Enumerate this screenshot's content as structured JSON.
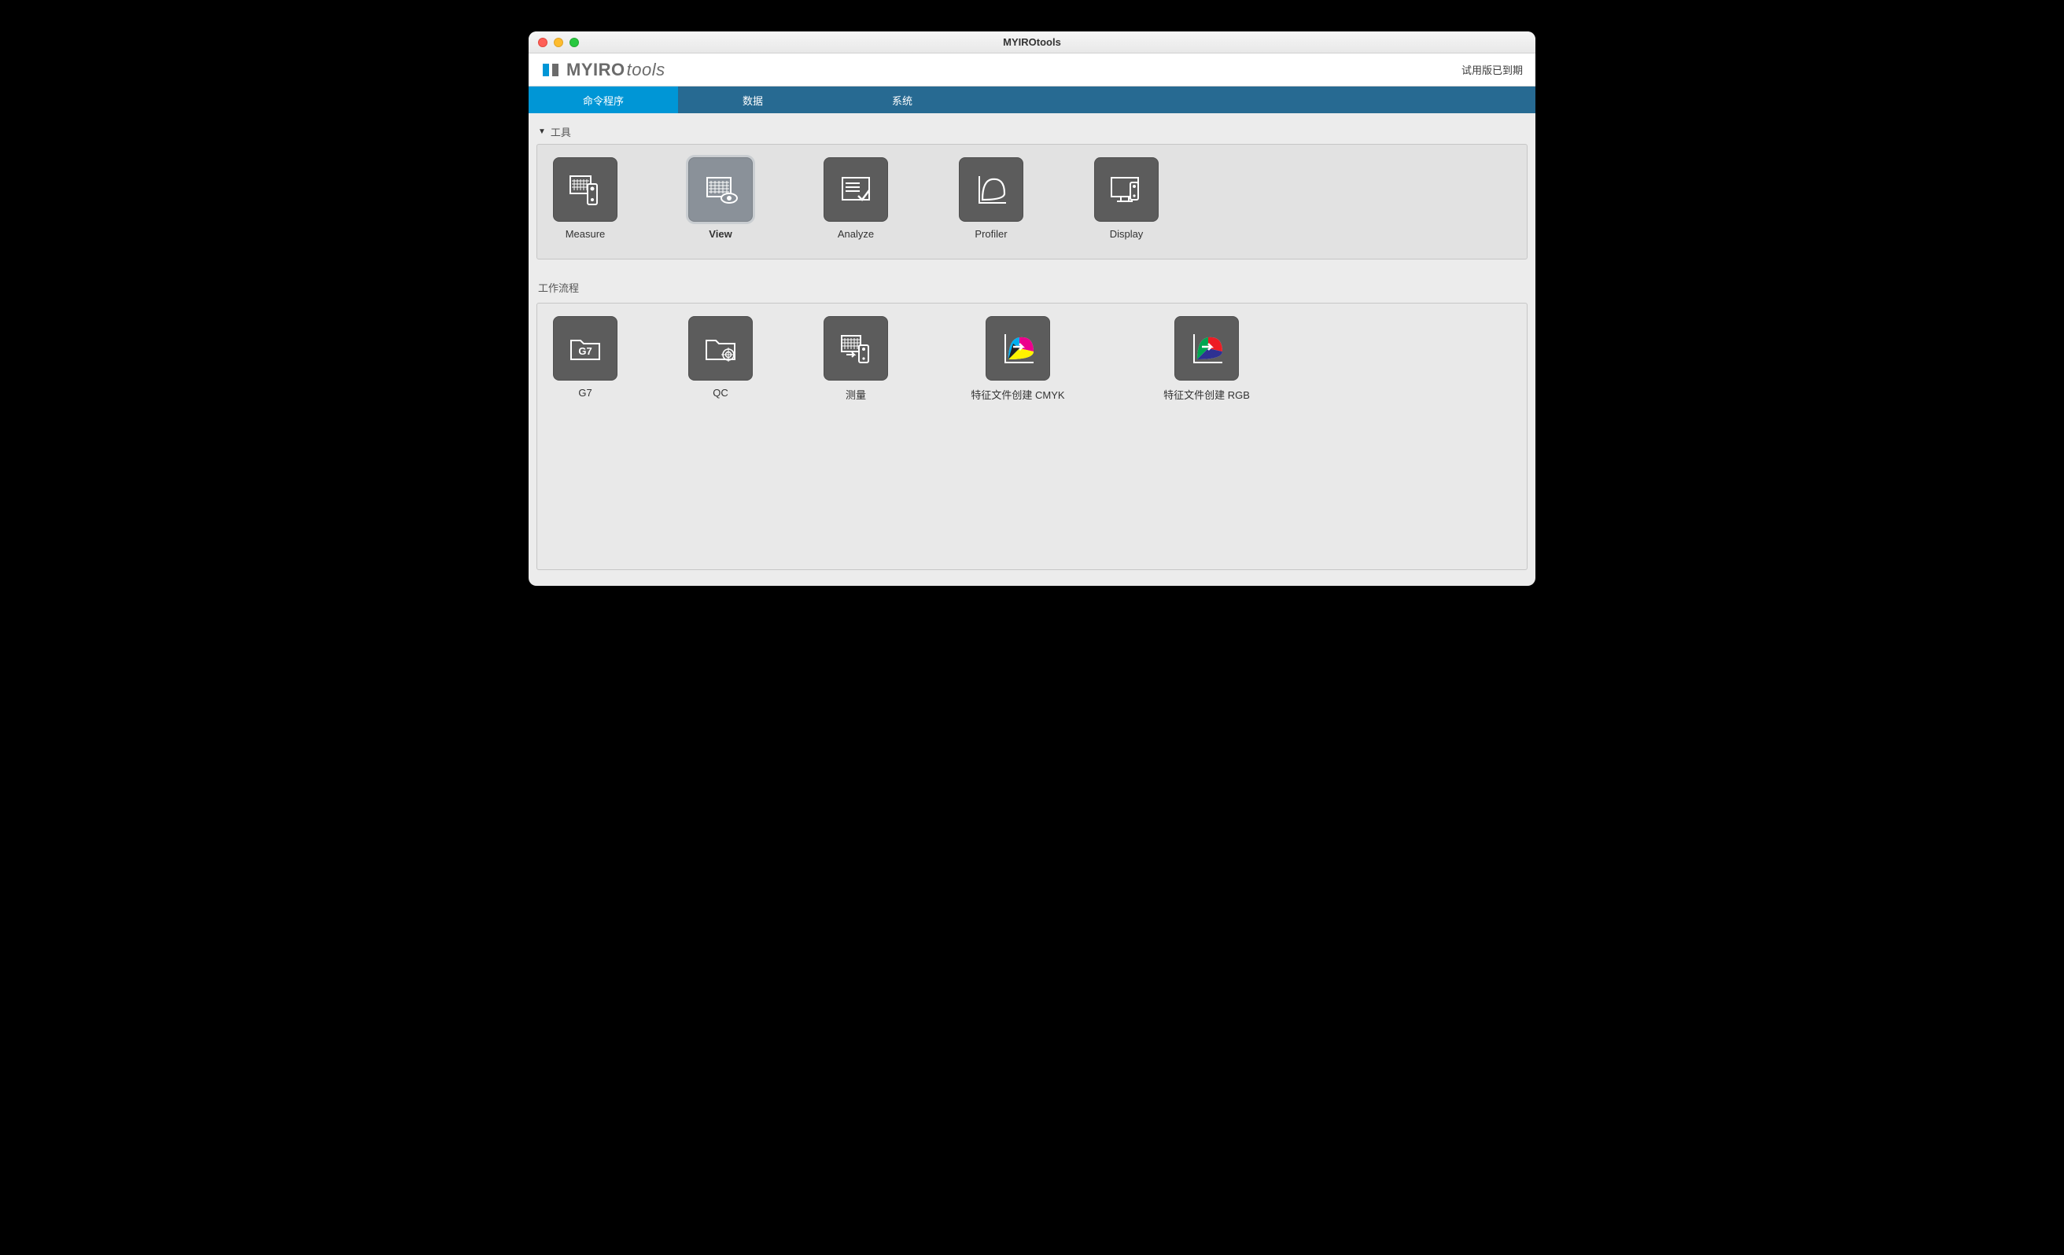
{
  "window": {
    "title": "MYIROtools"
  },
  "brand": {
    "name_bold": "MYIRO",
    "name_italic": "tools",
    "status": "试用版已到期"
  },
  "tabs": [
    {
      "id": "programs",
      "label": "命令程序",
      "active": true
    },
    {
      "id": "data",
      "label": "数据",
      "active": false
    },
    {
      "id": "system",
      "label": "系统",
      "active": false
    }
  ],
  "tools_section": {
    "title": "工具"
  },
  "tools": [
    {
      "id": "measure",
      "label": "Measure",
      "selected": false
    },
    {
      "id": "view",
      "label": "View",
      "selected": true
    },
    {
      "id": "analyze",
      "label": "Analyze",
      "selected": false
    },
    {
      "id": "profiler",
      "label": "Profiler",
      "selected": false
    },
    {
      "id": "display",
      "label": "Display",
      "selected": false
    }
  ],
  "workflow_section": {
    "title": "工作流程"
  },
  "workflows": [
    {
      "id": "g7",
      "label": "G7"
    },
    {
      "id": "qc",
      "label": "QC"
    },
    {
      "id": "meas",
      "label": "测量"
    },
    {
      "id": "pcmy",
      "label": "特征文件创建 CMYK"
    },
    {
      "id": "prgb",
      "label": "特征文件创建 RGB"
    }
  ]
}
